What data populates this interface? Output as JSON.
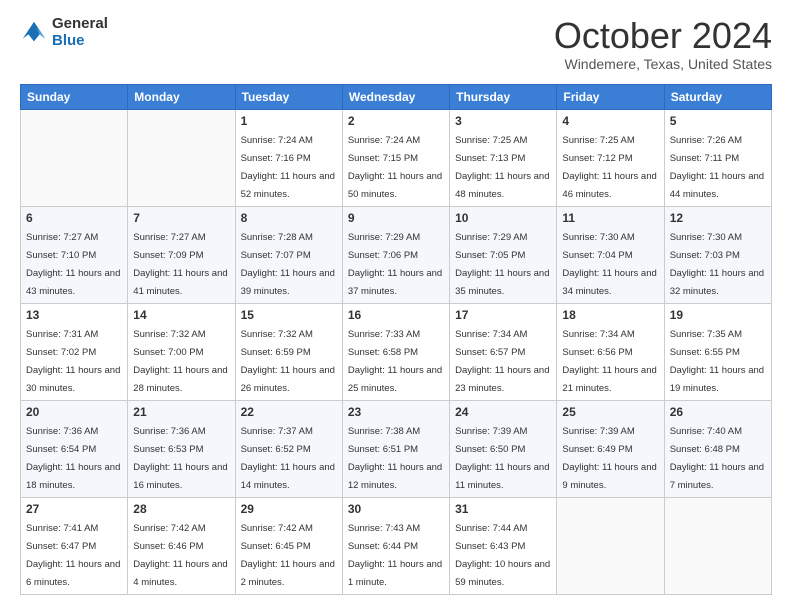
{
  "logo": {
    "general": "General",
    "blue": "Blue"
  },
  "header": {
    "month": "October 2024",
    "location": "Windemere, Texas, United States"
  },
  "weekdays": [
    "Sunday",
    "Monday",
    "Tuesday",
    "Wednesday",
    "Thursday",
    "Friday",
    "Saturday"
  ],
  "weeks": [
    [
      {
        "day": "",
        "info": ""
      },
      {
        "day": "",
        "info": ""
      },
      {
        "day": "1",
        "info": "Sunrise: 7:24 AM\nSunset: 7:16 PM\nDaylight: 11 hours and 52 minutes."
      },
      {
        "day": "2",
        "info": "Sunrise: 7:24 AM\nSunset: 7:15 PM\nDaylight: 11 hours and 50 minutes."
      },
      {
        "day": "3",
        "info": "Sunrise: 7:25 AM\nSunset: 7:13 PM\nDaylight: 11 hours and 48 minutes."
      },
      {
        "day": "4",
        "info": "Sunrise: 7:25 AM\nSunset: 7:12 PM\nDaylight: 11 hours and 46 minutes."
      },
      {
        "day": "5",
        "info": "Sunrise: 7:26 AM\nSunset: 7:11 PM\nDaylight: 11 hours and 44 minutes."
      }
    ],
    [
      {
        "day": "6",
        "info": "Sunrise: 7:27 AM\nSunset: 7:10 PM\nDaylight: 11 hours and 43 minutes."
      },
      {
        "day": "7",
        "info": "Sunrise: 7:27 AM\nSunset: 7:09 PM\nDaylight: 11 hours and 41 minutes."
      },
      {
        "day": "8",
        "info": "Sunrise: 7:28 AM\nSunset: 7:07 PM\nDaylight: 11 hours and 39 minutes."
      },
      {
        "day": "9",
        "info": "Sunrise: 7:29 AM\nSunset: 7:06 PM\nDaylight: 11 hours and 37 minutes."
      },
      {
        "day": "10",
        "info": "Sunrise: 7:29 AM\nSunset: 7:05 PM\nDaylight: 11 hours and 35 minutes."
      },
      {
        "day": "11",
        "info": "Sunrise: 7:30 AM\nSunset: 7:04 PM\nDaylight: 11 hours and 34 minutes."
      },
      {
        "day": "12",
        "info": "Sunrise: 7:30 AM\nSunset: 7:03 PM\nDaylight: 11 hours and 32 minutes."
      }
    ],
    [
      {
        "day": "13",
        "info": "Sunrise: 7:31 AM\nSunset: 7:02 PM\nDaylight: 11 hours and 30 minutes."
      },
      {
        "day": "14",
        "info": "Sunrise: 7:32 AM\nSunset: 7:00 PM\nDaylight: 11 hours and 28 minutes."
      },
      {
        "day": "15",
        "info": "Sunrise: 7:32 AM\nSunset: 6:59 PM\nDaylight: 11 hours and 26 minutes."
      },
      {
        "day": "16",
        "info": "Sunrise: 7:33 AM\nSunset: 6:58 PM\nDaylight: 11 hours and 25 minutes."
      },
      {
        "day": "17",
        "info": "Sunrise: 7:34 AM\nSunset: 6:57 PM\nDaylight: 11 hours and 23 minutes."
      },
      {
        "day": "18",
        "info": "Sunrise: 7:34 AM\nSunset: 6:56 PM\nDaylight: 11 hours and 21 minutes."
      },
      {
        "day": "19",
        "info": "Sunrise: 7:35 AM\nSunset: 6:55 PM\nDaylight: 11 hours and 19 minutes."
      }
    ],
    [
      {
        "day": "20",
        "info": "Sunrise: 7:36 AM\nSunset: 6:54 PM\nDaylight: 11 hours and 18 minutes."
      },
      {
        "day": "21",
        "info": "Sunrise: 7:36 AM\nSunset: 6:53 PM\nDaylight: 11 hours and 16 minutes."
      },
      {
        "day": "22",
        "info": "Sunrise: 7:37 AM\nSunset: 6:52 PM\nDaylight: 11 hours and 14 minutes."
      },
      {
        "day": "23",
        "info": "Sunrise: 7:38 AM\nSunset: 6:51 PM\nDaylight: 11 hours and 12 minutes."
      },
      {
        "day": "24",
        "info": "Sunrise: 7:39 AM\nSunset: 6:50 PM\nDaylight: 11 hours and 11 minutes."
      },
      {
        "day": "25",
        "info": "Sunrise: 7:39 AM\nSunset: 6:49 PM\nDaylight: 11 hours and 9 minutes."
      },
      {
        "day": "26",
        "info": "Sunrise: 7:40 AM\nSunset: 6:48 PM\nDaylight: 11 hours and 7 minutes."
      }
    ],
    [
      {
        "day": "27",
        "info": "Sunrise: 7:41 AM\nSunset: 6:47 PM\nDaylight: 11 hours and 6 minutes."
      },
      {
        "day": "28",
        "info": "Sunrise: 7:42 AM\nSunset: 6:46 PM\nDaylight: 11 hours and 4 minutes."
      },
      {
        "day": "29",
        "info": "Sunrise: 7:42 AM\nSunset: 6:45 PM\nDaylight: 11 hours and 2 minutes."
      },
      {
        "day": "30",
        "info": "Sunrise: 7:43 AM\nSunset: 6:44 PM\nDaylight: 11 hours and 1 minute."
      },
      {
        "day": "31",
        "info": "Sunrise: 7:44 AM\nSunset: 6:43 PM\nDaylight: 10 hours and 59 minutes."
      },
      {
        "day": "",
        "info": ""
      },
      {
        "day": "",
        "info": ""
      }
    ]
  ]
}
